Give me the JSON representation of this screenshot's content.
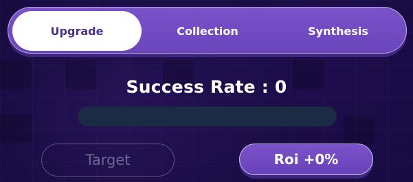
{
  "tabs": {
    "upgrade": "Upgrade",
    "collection": "Collection",
    "synthesis": "Synthesis"
  },
  "success": {
    "label": "Success Rate : ",
    "value": "0",
    "progress_fraction": 0
  },
  "buttons": {
    "target": "Target",
    "roi": "Roi +0%"
  },
  "colors": {
    "accent": "#7a52c9",
    "background": "#150b3e",
    "track": "#1b2a45",
    "active_tab_text": "#4a2f8a"
  }
}
